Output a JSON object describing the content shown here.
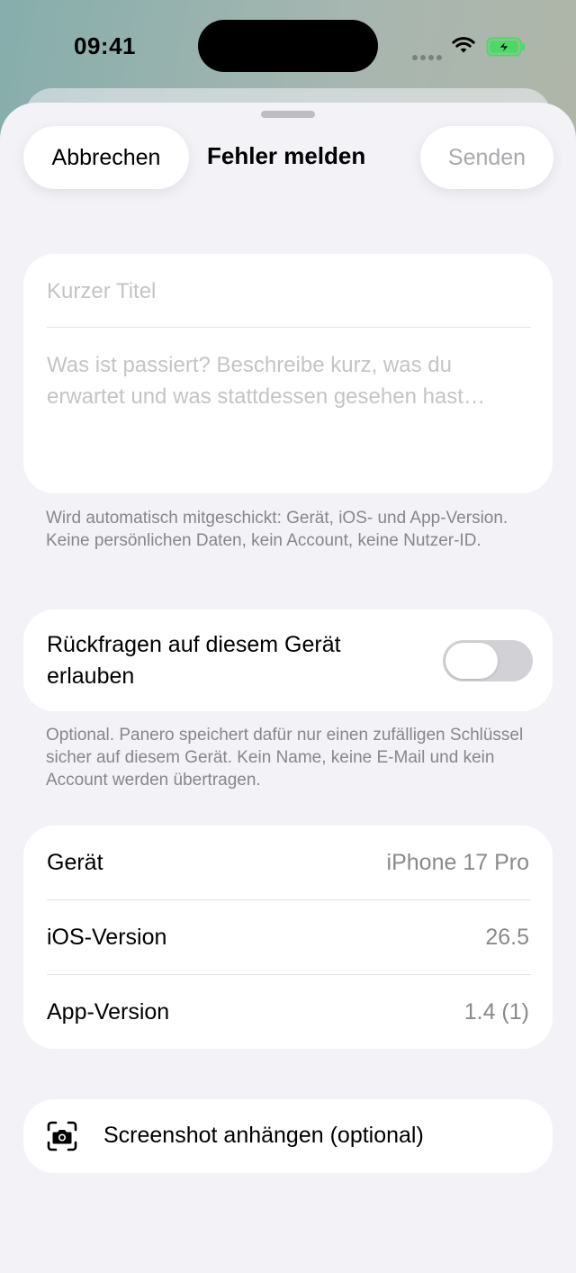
{
  "status_bar": {
    "time": "09:41",
    "icons": [
      "wifi-icon",
      "battery-charging-icon"
    ]
  },
  "nav": {
    "cancel_label": "Abbrechen",
    "title": "Fehler melden",
    "send_label": "Senden"
  },
  "form": {
    "title_placeholder": "Kurzer Titel",
    "description_placeholder": "Was ist passiert? Beschreibe kurz, was du erwartet und was stattdessen gesehen hast…",
    "footnote": "Wird automatisch mitgeschickt: Gerät, iOS- und App-Version. Keine persönlichen Daten, kein Account, keine Nutzer-ID."
  },
  "followup": {
    "label": "Rückfragen auf diesem Gerät erlauben",
    "enabled": false,
    "footnote": "Optional. Panero speichert dafür nur einen zufälligen Schlüssel sicher auf diesem Gerät. Kein Name, keine E-Mail und kein Account werden übertragen."
  },
  "info": {
    "rows": [
      {
        "label": "Gerät",
        "value": "iPhone 17 Pro"
      },
      {
        "label": "iOS-Version",
        "value": "26.5"
      },
      {
        "label": "App-Version",
        "value": "1.4 (1)"
      }
    ]
  },
  "screenshot": {
    "label": "Screenshot anhängen (optional)",
    "icon": "camera-viewfinder-icon"
  },
  "colors": {
    "background": "#f2f2f7",
    "card": "#ffffff",
    "placeholder": "#c4c4c7",
    "secondary_text": "#8a8a8e",
    "toggle_off": "#d2d2d6",
    "battery_green": "#4cd964"
  }
}
